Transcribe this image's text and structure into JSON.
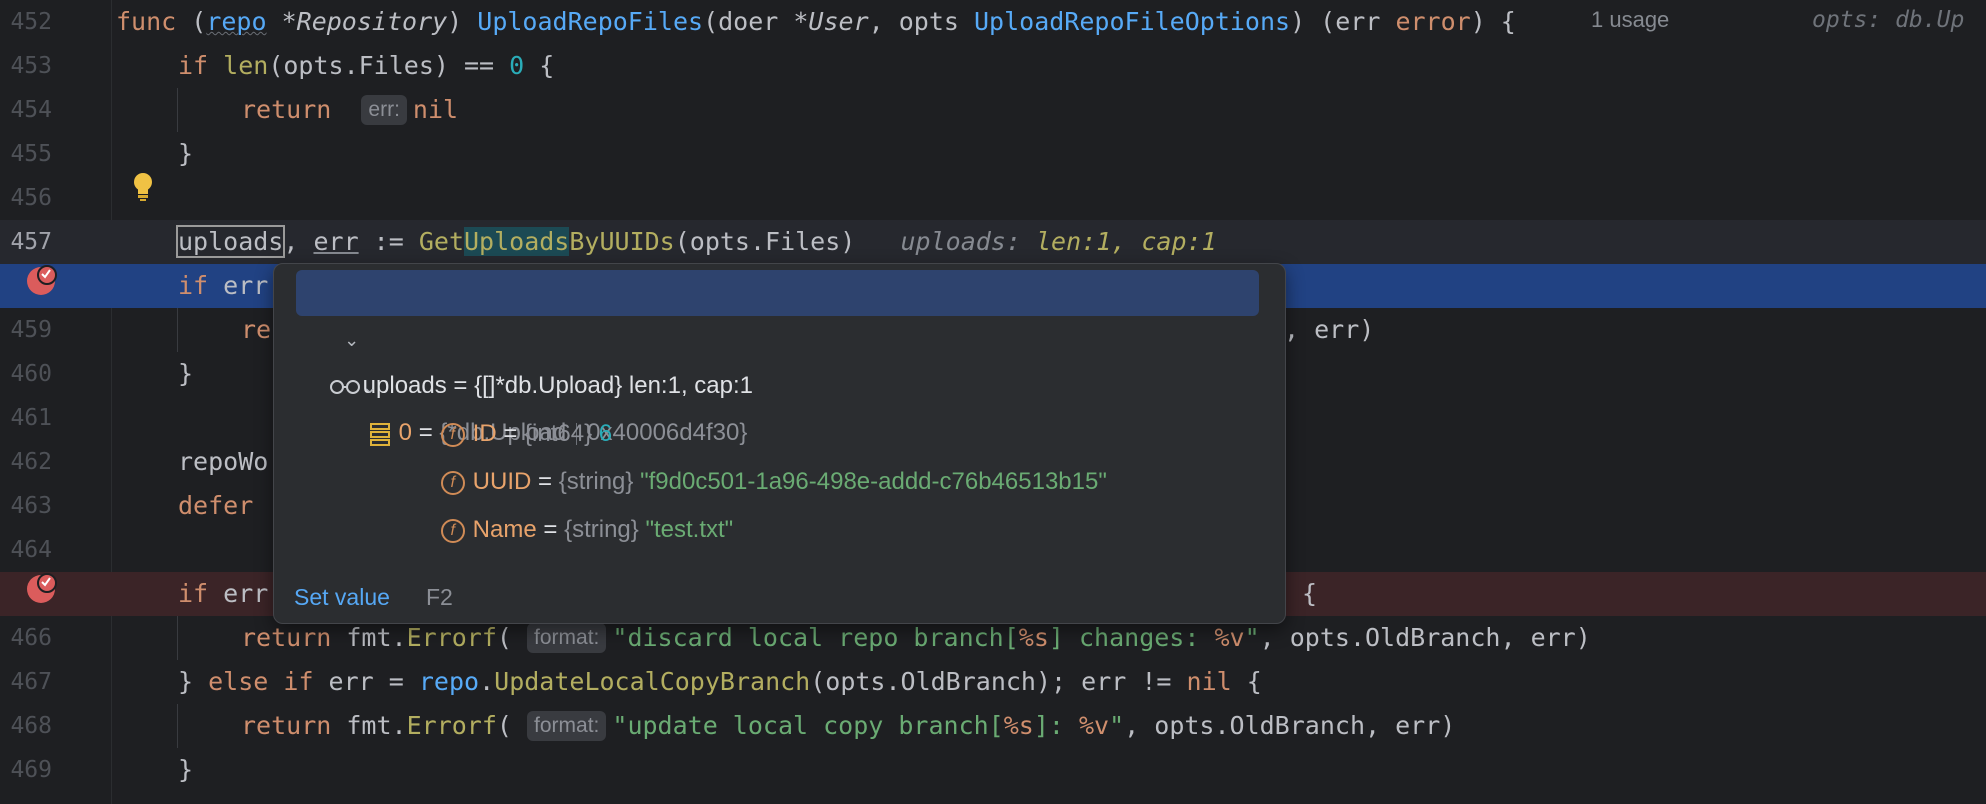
{
  "editor": {
    "line_numbers": [
      "452",
      "453",
      "454",
      "455",
      "456",
      "457",
      "458",
      "459",
      "460",
      "461",
      "462",
      "463",
      "464",
      "465",
      "466",
      "467",
      "468",
      "469"
    ],
    "current_line": "457",
    "usage_hint": "1 usage",
    "right_hint": "opts: db.Up",
    "lines": {
      "l452": {
        "kw_func": "func",
        "p1": " (",
        "recv": "repo",
        "p2": " *",
        "recv_type": "Repository",
        "p3": ") ",
        "name": "UploadRepoFiles",
        "p4": "(doer *",
        "t1": "User",
        "p5": ", opts ",
        "t2": "UploadRepoFileOptions",
        "p6": ") (err ",
        "t3": "error",
        "p7": ") {"
      },
      "l453": {
        "kw": "if",
        "sp": " ",
        "len": "len",
        "rest": "(opts.Files) == ",
        "num": "0",
        "end": " {"
      },
      "l454": {
        "kw": "return",
        "hint": "err:",
        "val": "nil"
      },
      "l455": {
        "text": "}"
      },
      "l457": {
        "var1": "uploads",
        "mid": ", ",
        "var2": "err",
        "op": " := ",
        "call_a": "Get",
        "call_b": "Uploads",
        "call_c": "ByUUIDs",
        "args": "(opts.Files)",
        "iv_name": "uploads:",
        "iv_val": "len:1, cap:1"
      },
      "l458": {
        "kw": "if",
        "rest": " err"
      },
      "l459": {
        "pre": "re",
        "tail": ", err)"
      },
      "l460": {
        "text": "}"
      },
      "l462": {
        "text": "repoWo"
      },
      "l463": {
        "kw": "defer"
      },
      "l465": {
        "kw": "if",
        "rest": " err",
        "tail": "{"
      },
      "l466": {
        "kw": "return",
        "pkg": "fmt.",
        "fn": "Errorf",
        "open": "(",
        "hint": "format:",
        "str_a": "\"discard local repo branch[",
        "fmt1": "%s",
        "str_b": "] changes: ",
        "fmt2": "%v",
        "str_c": "\"",
        "rest": ", opts.OldBranch, err)"
      },
      "l467": {
        "brace": "} ",
        "kw1": "else",
        "kw2": "if",
        "a": " err = ",
        "recv": "repo",
        "dot": ".",
        "fn": "UpdateLocalCopyBranch",
        "b": "(opts.OldBranch); err != ",
        "nil": "nil",
        "c": " {"
      },
      "l468": {
        "kw": "return",
        "pkg": "fmt.",
        "fn": "Errorf",
        "open": "(",
        "hint": "format:",
        "str_a": "\"update local copy branch[",
        "fmt1": "%s",
        "str_b": "]: ",
        "fmt2": "%v",
        "str_c": "\"",
        "rest": ", opts.OldBranch, err)"
      },
      "l469": {
        "text": "}"
      }
    }
  },
  "popup": {
    "root": {
      "name": "uploads",
      "eq": " = ",
      "value": "{[]*db.Upload} len:1, cap:1"
    },
    "item0": {
      "name": "0",
      "eq": " = ",
      "type": "{*db.Upload",
      "addr": "0x40006d4f30}"
    },
    "fields": [
      {
        "badge": "f",
        "name": "ID",
        "eq": " = ",
        "type": "{int64}",
        "value": "6"
      },
      {
        "badge": "f",
        "name": "UUID",
        "eq": " = ",
        "type": "{string}",
        "value": "\"f9d0c501-1a96-498e-addd-c76b46513b15\""
      },
      {
        "badge": "f",
        "name": "Name",
        "eq": " = ",
        "type": "{string}",
        "value": "\"test.txt\""
      }
    ],
    "set_value": "Set value",
    "set_value_key": "F2"
  },
  "colors": {
    "background": "#1e1f22",
    "execution_line": "#214283",
    "breakpoint": "#db5c5c",
    "popup_bg": "#2b2d30"
  }
}
